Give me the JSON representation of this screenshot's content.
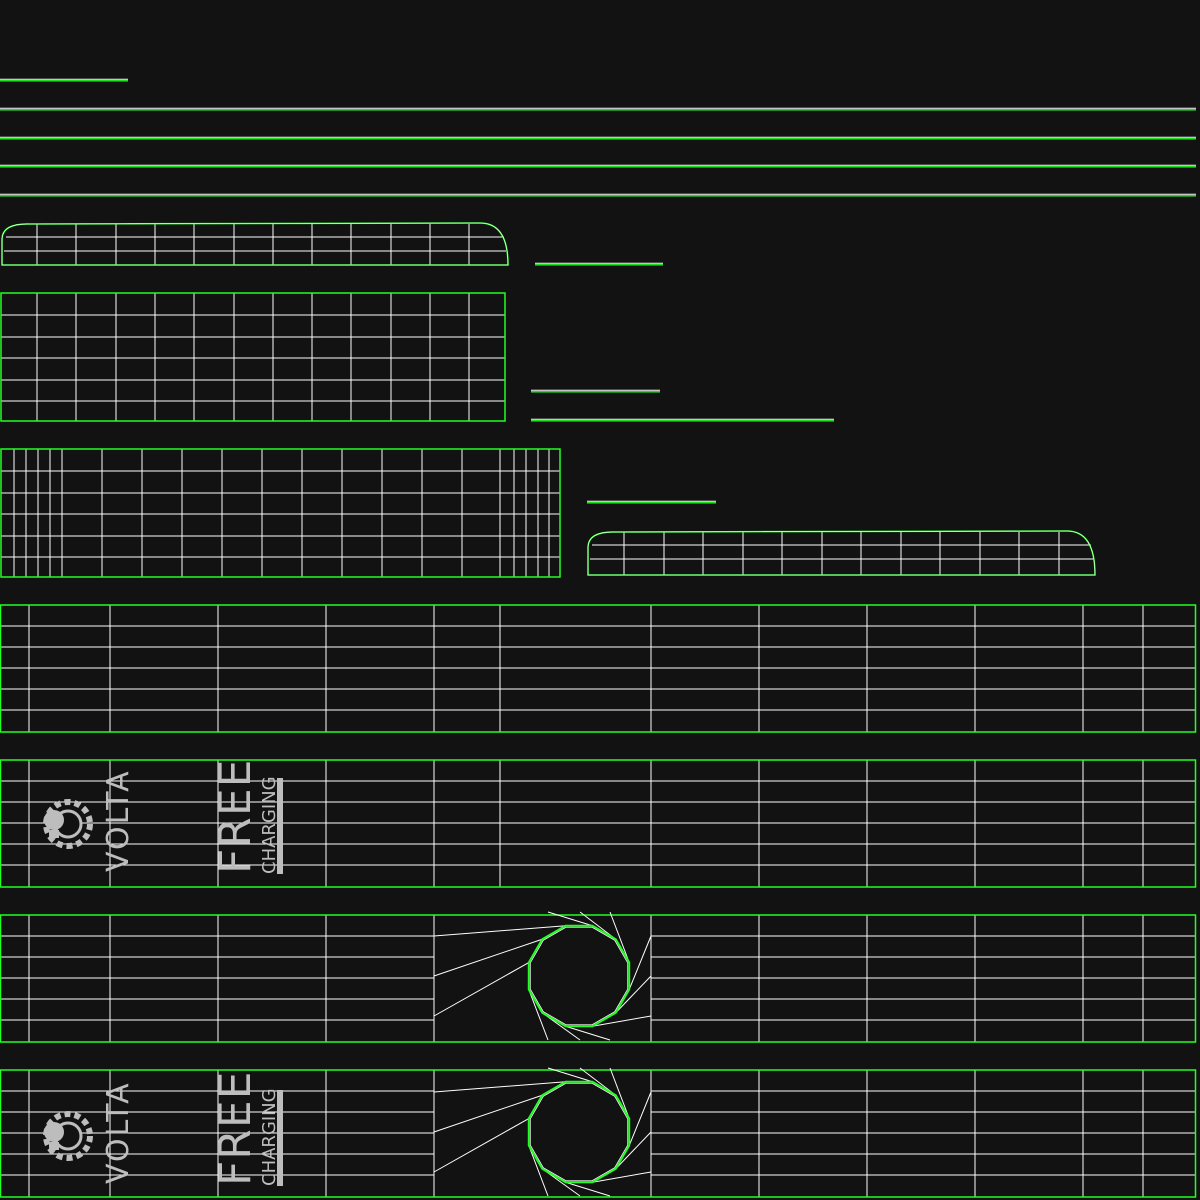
{
  "canvas": {
    "background": "#121212",
    "wire_color": "#ffffff",
    "edge_color": "#22ff22"
  },
  "logos": [
    {
      "brand": "VOLTA",
      "tagline_big": "FREE",
      "tagline_small": "CHARGING",
      "icon": "bulb-gear-icon"
    },
    {
      "brand": "VOLTA",
      "tagline_big": "FREE",
      "tagline_small": "CHARGING",
      "icon": "bulb-gear-icon"
    }
  ]
}
